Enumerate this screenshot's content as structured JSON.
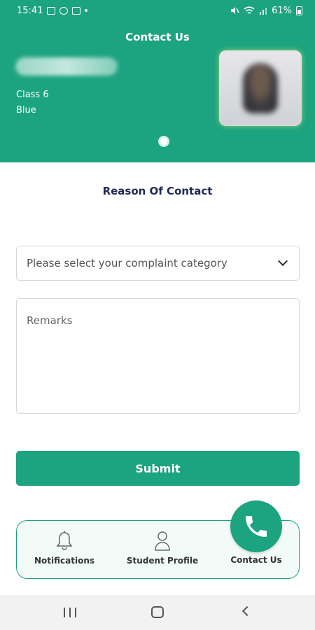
{
  "status_bar": {
    "time": "15:41",
    "battery": "61%"
  },
  "header": {
    "title": "Contact Us",
    "student_class": "Class 6",
    "student_house": "Blue"
  },
  "form": {
    "section_title": "Reason Of Contact",
    "category_placeholder": "Please select your complaint category",
    "remarks_placeholder": "Remarks",
    "submit_label": "Submit"
  },
  "bottom_nav": {
    "items": [
      {
        "label": "Notifications",
        "icon": "bell-icon"
      },
      {
        "label": "Student Profile",
        "icon": "person-icon"
      },
      {
        "label": "Contact Us",
        "icon": "phone-icon"
      }
    ]
  },
  "colors": {
    "primary": "#1ca37f",
    "title_text": "#1f2a55"
  }
}
